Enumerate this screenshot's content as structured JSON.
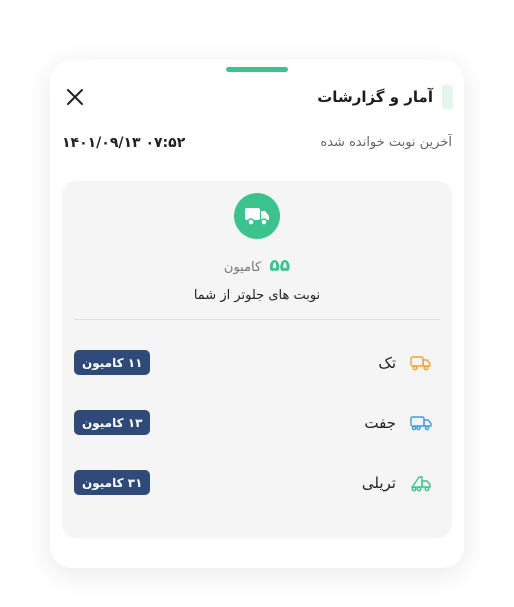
{
  "header": {
    "title": "آمار و گزارشات"
  },
  "last_turn": {
    "label": "آخرین نوبت خوانده شده",
    "value": "۱۴۰۱/۰۹/۱۳ ۰۷:۵۲"
  },
  "summary": {
    "count": "۵۵",
    "unit": "کامیون",
    "caption": "نوبت های جلوتر از شما"
  },
  "categories": [
    {
      "name": "تک",
      "badge": "۱۱ کامیون",
      "icon": "single-truck-icon",
      "color": "#f0a23a"
    },
    {
      "name": "جفت",
      "badge": "۱۳ کامیون",
      "icon": "double-truck-icon",
      "color": "#3b9fe0"
    },
    {
      "name": "تریلی",
      "badge": "۳۱ کامیون",
      "icon": "trailer-truck-icon",
      "color": "#3cc28d"
    }
  ],
  "colors": {
    "accent": "#3cc28d",
    "badge": "#2f4a78",
    "card": "#f5f5f5"
  }
}
